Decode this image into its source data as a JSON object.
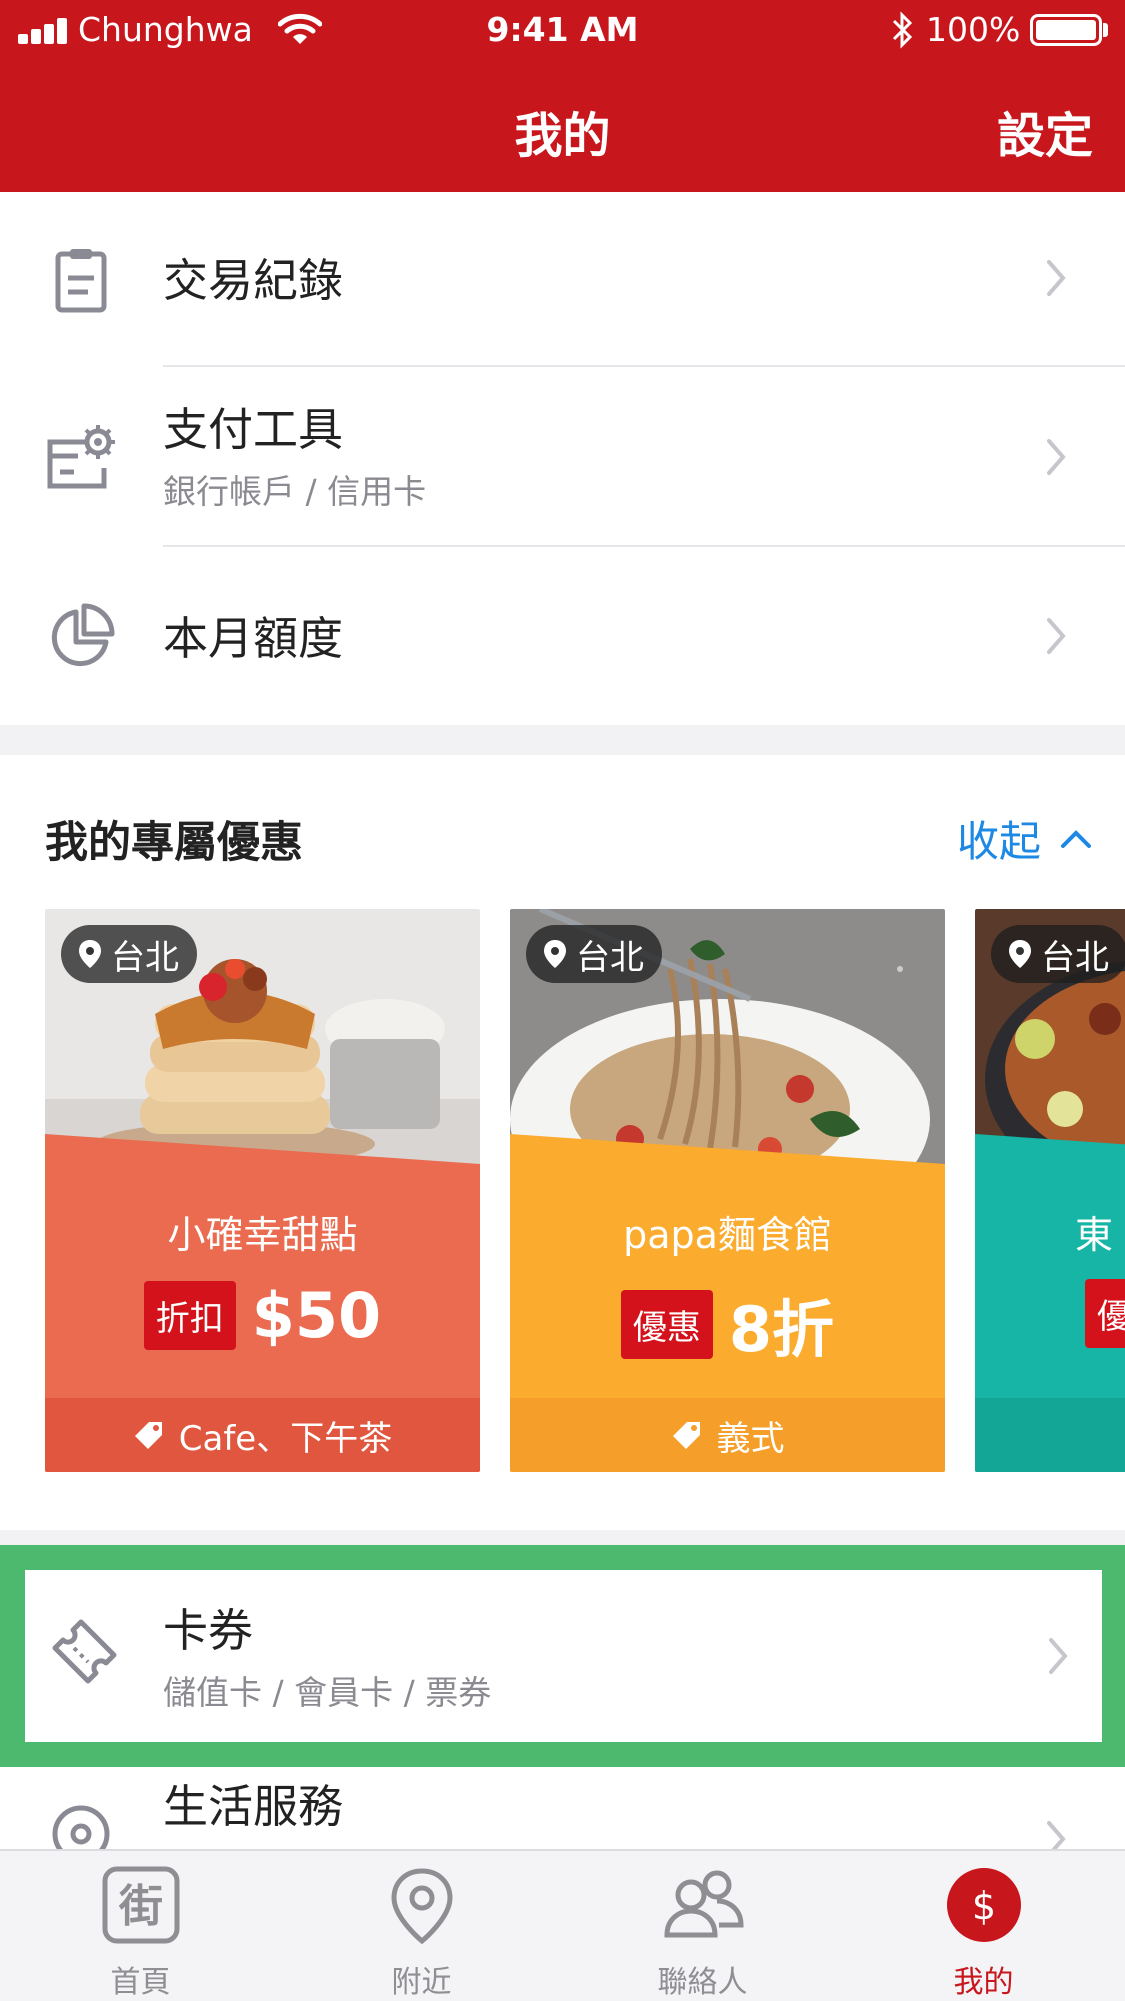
{
  "status_bar": {
    "carrier": "Chunghwa",
    "time": "9:41 AM",
    "battery_percent": "100%"
  },
  "nav": {
    "title": "我的",
    "action": "設定"
  },
  "menu": {
    "transactions": {
      "title": "交易紀錄"
    },
    "payment": {
      "title": "支付工具",
      "subtitle": "銀行帳戶 / 信用卡"
    },
    "quota": {
      "title": "本月額度"
    }
  },
  "offers": {
    "title": "我的專屬優惠",
    "collapse": "收起",
    "cards": [
      {
        "location": "台北",
        "shop": "小確幸甜點",
        "badge": "折扣",
        "value": "$50",
        "tag": "Cafe、下午茶",
        "color": "#ea6b4f",
        "tag_color": "#e0563e"
      },
      {
        "location": "台北",
        "shop": "papa麵食館",
        "badge": "優惠",
        "value": "8折",
        "tag": "義式",
        "color": "#fbab2d",
        "tag_color": "#f59f2a"
      },
      {
        "location": "台北",
        "shop": "東",
        "badge": "優",
        "value": "",
        "tag": "",
        "color": "#16b5a5",
        "tag_color": "#13a595"
      }
    ]
  },
  "vouchers": {
    "title": "卡券",
    "subtitle": "儲值卡 / 會員卡 / 票券"
  },
  "life_services": {
    "title": "生活服務"
  },
  "tabs": [
    {
      "label": "首頁",
      "icon": "street-icon"
    },
    {
      "label": "附近",
      "icon": "location-pin-icon"
    },
    {
      "label": "聯絡人",
      "icon": "contacts-icon"
    },
    {
      "label": "我的",
      "icon": "dollar-icon"
    }
  ],
  "colors": {
    "brand": "#c8161d",
    "highlight": "#4cb96e",
    "link": "#1e88e5"
  }
}
